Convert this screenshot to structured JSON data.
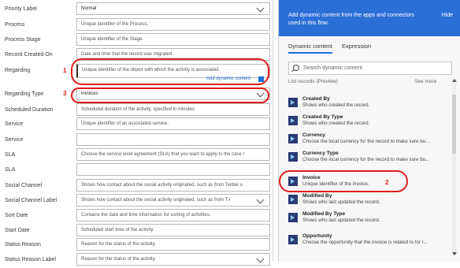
{
  "form": {
    "rows": [
      {
        "label": "Priority Label",
        "value": "Normal",
        "is_value": true,
        "dropdown": true
      },
      {
        "label": "Process",
        "value": "Unique identifier of the Process.",
        "is_value": false,
        "dropdown": false
      },
      {
        "label": "Process Stage",
        "value": "Unique identifier of the Stage.",
        "is_value": false,
        "dropdown": false
      },
      {
        "label": "Record Created On",
        "value": "Date and time that the record was migrated.",
        "is_value": false,
        "dropdown": false
      },
      {
        "label": "Regarding",
        "value": "Unique identifier of the object with which the activity is associated.",
        "is_value": false,
        "dropdown": false
      },
      {
        "label": "Regarding Type",
        "value": "invoices",
        "is_value": true,
        "dropdown": true
      },
      {
        "label": "Scheduled Duration",
        "value": "Scheduled duration of the activity, specified in minutes.",
        "is_value": false,
        "dropdown": false
      },
      {
        "label": "Service",
        "value": "Unique identifier of an associated service.",
        "is_value": false,
        "dropdown": false
      },
      {
        "label": "Service",
        "value": "",
        "is_value": false,
        "dropdown": false
      },
      {
        "label": "SLA",
        "value": "Choose the service level agreement (SLA) that you want to apply to the case r",
        "is_value": false,
        "dropdown": false
      },
      {
        "label": "SLA",
        "value": "",
        "is_value": false,
        "dropdown": false
      },
      {
        "label": "Social Channel",
        "value": "Shows how contact about the social activity originated, such as from Twitter o",
        "is_value": false,
        "dropdown": false
      },
      {
        "label": "Social Channel Label",
        "value": "Shows how contact about the social activity originated, such as from Tv",
        "is_value": false,
        "dropdown": true
      },
      {
        "label": "Sort Date",
        "value": "Contains the date and time information for sorting of activities.",
        "is_value": false,
        "dropdown": false
      },
      {
        "label": "Start Date",
        "value": "Scheduled start time of the activity.",
        "is_value": false,
        "dropdown": false
      },
      {
        "label": "Status Reason",
        "value": "Reason for the status of the activity.",
        "is_value": false,
        "dropdown": false
      },
      {
        "label": "Status Reason Label",
        "value": "Reason for the status of the activity.",
        "is_value": false,
        "dropdown": true
      }
    ],
    "add_dynamic": "Add dynamic content",
    "annotations": {
      "one": "1",
      "two": "2",
      "three": "3"
    }
  },
  "panel": {
    "header_text": "Add dynamic content from the apps and connectors used in this flow.",
    "hide_label": "Hide",
    "tabs": [
      "Dynamic content",
      "Expression"
    ],
    "search_placeholder": "Search dynamic content",
    "list_header": "List records (Preview)",
    "see_more": "See more",
    "items": [
      {
        "title": "Created By",
        "desc": "Shows who created the record."
      },
      {
        "title": "Created By Type",
        "desc": "Shows who created the record."
      },
      {
        "title": "Currency",
        "desc": "Choose the local currency for the record to make sure bu..."
      },
      {
        "title": "Currency Type",
        "desc": "Choose the local currency for the record to make sure bu..."
      },
      {
        "title": "Invoice",
        "desc": "Unique identifier of the invoice."
      },
      {
        "title": "Modified By",
        "desc": "Shows who last updated the record."
      },
      {
        "title": "Modified By Type",
        "desc": "Shows who last updated the record."
      },
      {
        "title": "Opportunity",
        "desc": "Choose the opportunity that the invoice is related to for r..."
      }
    ],
    "colors": {
      "accent": "#2b6fd6",
      "annotation": "#e01b1b",
      "icon": "#2b3a73"
    }
  }
}
